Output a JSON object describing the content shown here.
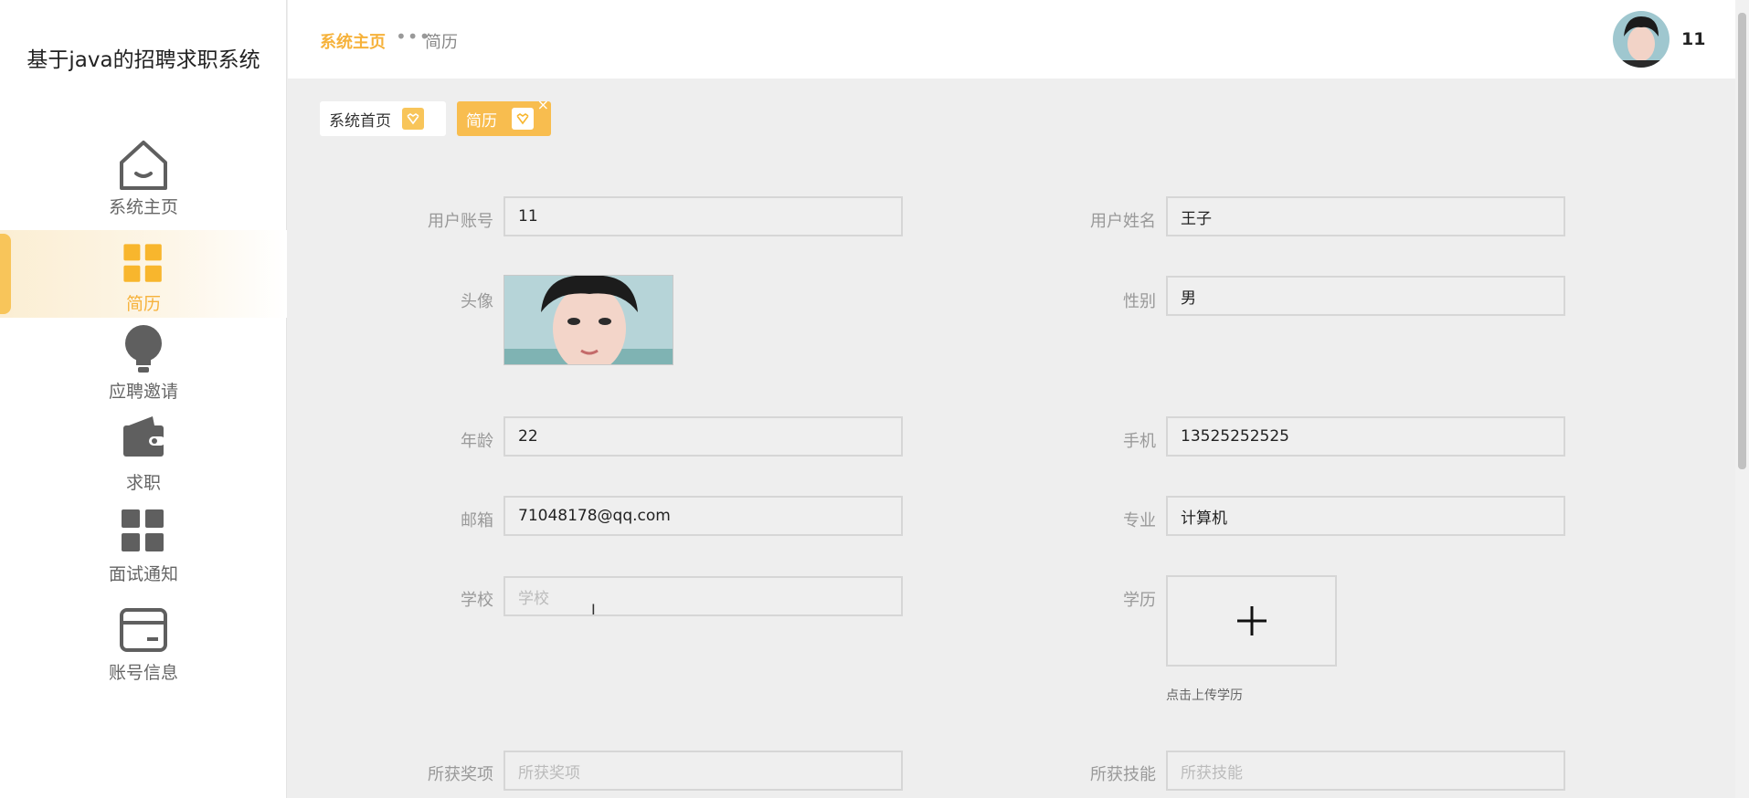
{
  "app": {
    "title": "基于java的招聘求职系统"
  },
  "sidebar": {
    "items": [
      {
        "label": "系统主页",
        "icon": "home-icon"
      },
      {
        "label": "简历",
        "icon": "grid-icon"
      },
      {
        "label": "应聘邀请",
        "icon": "lightbulb-icon"
      },
      {
        "label": "求职",
        "icon": "wallet-icon"
      },
      {
        "label": "面试通知",
        "icon": "grid-icon"
      },
      {
        "label": "账号信息",
        "icon": "card-icon"
      }
    ],
    "active_index": 1
  },
  "header": {
    "breadcrumb_home": "系统主页",
    "breadcrumb_current": "简历",
    "username": "11"
  },
  "tabs": [
    {
      "label": "系统首页"
    },
    {
      "label": "简历",
      "close": "×"
    }
  ],
  "form": {
    "account": {
      "label": "用户账号",
      "value": "11"
    },
    "name": {
      "label": "用户姓名",
      "value": "王子"
    },
    "avatar": {
      "label": "头像"
    },
    "gender": {
      "label": "性别",
      "value": "男"
    },
    "age": {
      "label": "年龄",
      "value": "22"
    },
    "phone": {
      "label": "手机",
      "value": "13525252525"
    },
    "email": {
      "label": "邮箱",
      "value": "71048178@qq.com"
    },
    "major": {
      "label": "专业",
      "value": "计算机"
    },
    "school": {
      "label": "学校",
      "placeholder": "学校"
    },
    "education": {
      "label": "学历",
      "upload_hint": "点击上传学历"
    },
    "awards": {
      "label": "所获奖项",
      "placeholder": "所获奖项"
    },
    "skills": {
      "label": "所获技能",
      "placeholder": "所获技能"
    }
  },
  "colors": {
    "accent": "#f6b23b",
    "sidebar_icon": "#5f5f5f"
  }
}
